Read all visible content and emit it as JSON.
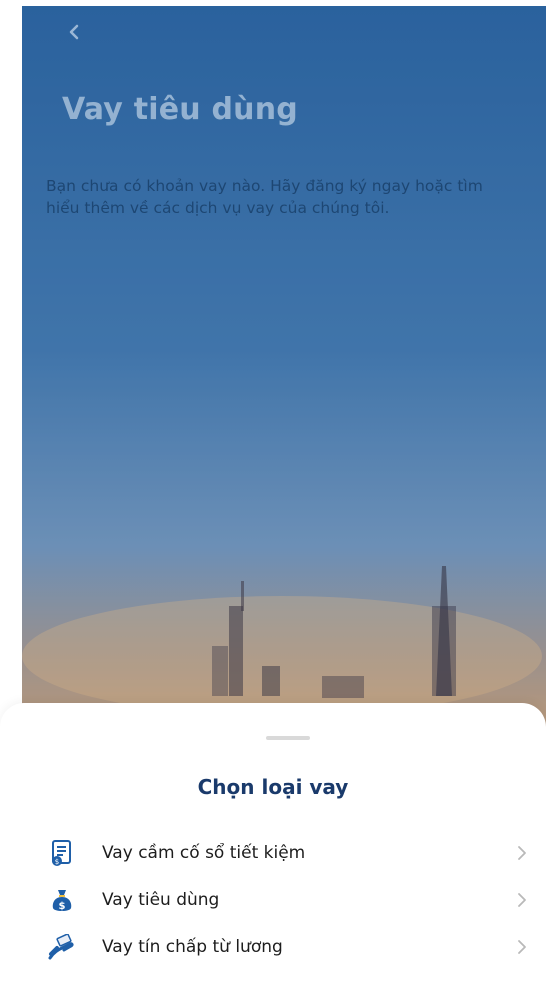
{
  "header": {
    "title": "Vay tiêu dùng",
    "back_icon": "chevron-left-icon"
  },
  "main": {
    "description": "Bạn chưa có khoản vay nào. Hãy đăng ký ngay hoặc tìm hiểu thêm về các dịch vụ vay của chúng tôi."
  },
  "sheet": {
    "title": "Chọn loại vay",
    "options": [
      {
        "label": "Vay cầm cố sổ tiết kiệm",
        "icon": "savings-book-icon"
      },
      {
        "label": "Vay tiêu dùng",
        "icon": "money-bag-icon"
      },
      {
        "label": "Vay tín chấp từ lương",
        "icon": "hand-money-icon"
      }
    ]
  },
  "colors": {
    "accent": "#1a3a6b",
    "icon": "#1f5fa8",
    "chevron": "#b9b9b9"
  }
}
